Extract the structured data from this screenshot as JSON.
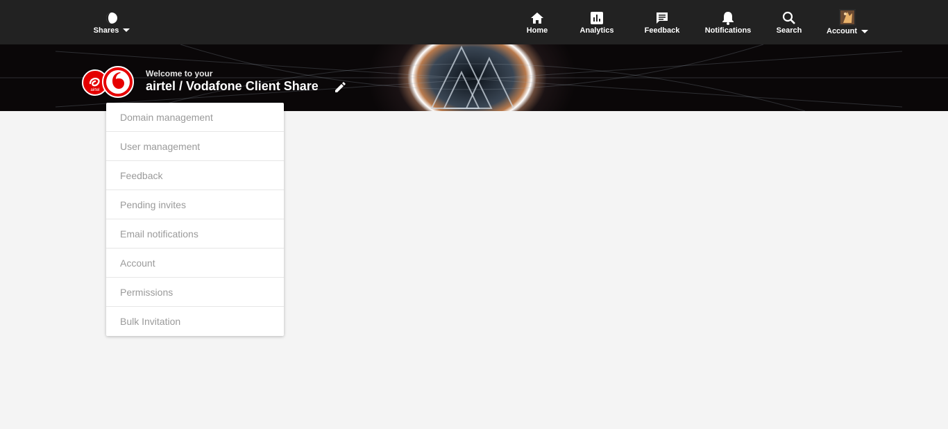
{
  "nav": {
    "shares_label": "Shares",
    "home_label": "Home",
    "analytics_label": "Analytics",
    "feedback_label": "Feedback",
    "notifications_label": "Notifications",
    "search_label": "Search",
    "account_label": "Account"
  },
  "banner": {
    "welcome_text": "Welcome to your",
    "share_name": "airtel / Vodafone Client Share"
  },
  "menu": {
    "items": [
      "Domain management",
      "User management",
      "Feedback",
      "Pending invites",
      "Email notifications",
      "Account",
      "Permissions",
      "Bulk Invitation"
    ]
  },
  "logo": {
    "airtel_text": "airtel"
  },
  "colors": {
    "nav_bg": "#222222",
    "page_bg": "#f4f4f4",
    "brand_red": "#e60000",
    "menu_text": "#9a9a9a"
  }
}
